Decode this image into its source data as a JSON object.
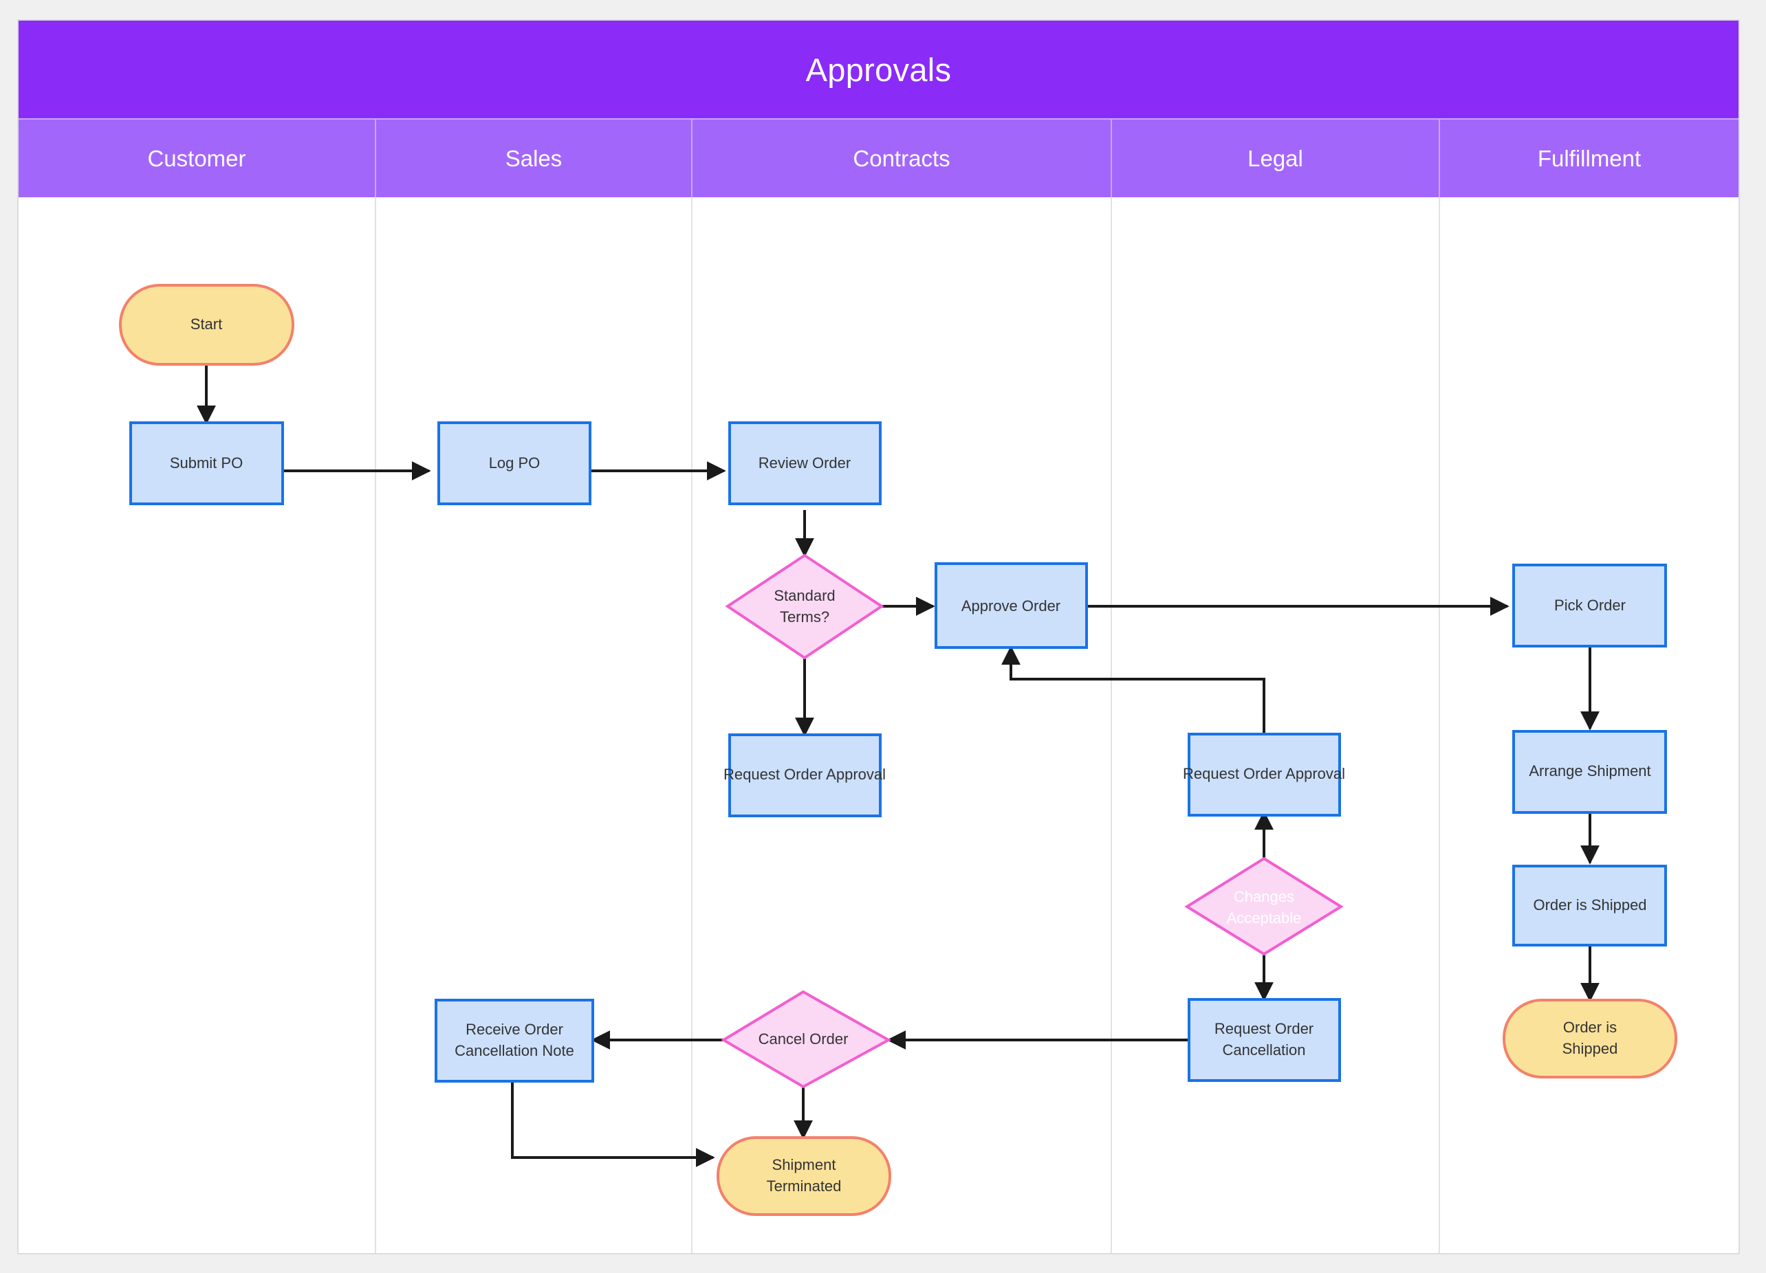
{
  "diagram": {
    "title": "Approvals",
    "type": "swimlane-flowchart",
    "colors": {
      "title_bar": "#8A2BF7",
      "lane_header": "#A366FB",
      "page_background": "#F0F0F0",
      "canvas": "#FFFFFF",
      "process_fill": "#CCE0FC",
      "process_border": "#1A73E8",
      "decision_fill": "#FBD9F5",
      "decision_border": "#F25FD0",
      "terminal_fill": "#FBE29A",
      "terminal_border": "#F4806A",
      "connector": "#1A1A1A",
      "lane_divider": "#E2E2E2"
    },
    "lanes": [
      {
        "id": "customer",
        "label": "Customer"
      },
      {
        "id": "sales",
        "label": "Sales"
      },
      {
        "id": "contracts",
        "label": "Contracts"
      },
      {
        "id": "legal",
        "label": "Legal"
      },
      {
        "id": "fulfillment",
        "label": "Fulfillment"
      }
    ],
    "nodes": [
      {
        "id": "start",
        "label": "Start",
        "shape": "terminal",
        "lane": "customer"
      },
      {
        "id": "submit_po",
        "label": "Submit PO",
        "shape": "process",
        "lane": "customer"
      },
      {
        "id": "log_po",
        "label": "Log PO",
        "shape": "process",
        "lane": "sales"
      },
      {
        "id": "review_order",
        "label": "Review Order",
        "shape": "process",
        "lane": "contracts"
      },
      {
        "id": "standard_terms",
        "label": "Standard Terms?",
        "label_line1": "Standard",
        "label_line2": "Terms?",
        "shape": "decision",
        "lane": "contracts"
      },
      {
        "id": "approve_order",
        "label": "Approve Order",
        "shape": "process",
        "lane": "contracts"
      },
      {
        "id": "contracts_request_approval",
        "label": "Request Order Approval",
        "shape": "process",
        "lane": "contracts"
      },
      {
        "id": "legal_request_approval",
        "label": "Request Order Approval",
        "shape": "process",
        "lane": "legal"
      },
      {
        "id": "changes_acceptable",
        "label": "Changes Acceptable",
        "label_line1": "Changes",
        "label_line2": "Acceptable",
        "shape": "decision",
        "lane": "legal",
        "text_color": "white"
      },
      {
        "id": "request_cancellation",
        "label": "Request Order Cancellation",
        "label_line1": "Request Order",
        "label_line2": "Cancellation",
        "shape": "process",
        "lane": "legal"
      },
      {
        "id": "cancel_order",
        "label": "Cancel Order",
        "shape": "decision",
        "lane": "contracts"
      },
      {
        "id": "receive_cancellation_note",
        "label": "Receive Order Cancellation Note",
        "label_line1": "Receive Order",
        "label_line2": "Cancellation Note",
        "shape": "process",
        "lane": "sales"
      },
      {
        "id": "shipment_terminated",
        "label": "Shipment Terminated",
        "label_line1": "Shipment",
        "label_line2": "Terminated",
        "shape": "terminal",
        "lane": "contracts"
      },
      {
        "id": "pick_order",
        "label": "Pick Order",
        "shape": "process",
        "lane": "fulfillment"
      },
      {
        "id": "arrange_shipment",
        "label": "Arrange Shipment",
        "shape": "process",
        "lane": "fulfillment"
      },
      {
        "id": "order_is_shipped_step",
        "label": "Order is Shipped",
        "shape": "process",
        "lane": "fulfillment"
      },
      {
        "id": "order_is_shipped_end",
        "label": "Order is Shipped",
        "label_line1": "Order is",
        "label_line2": "Shipped",
        "shape": "terminal",
        "lane": "fulfillment"
      }
    ],
    "edges": [
      {
        "from": "start",
        "to": "submit_po"
      },
      {
        "from": "submit_po",
        "to": "log_po"
      },
      {
        "from": "log_po",
        "to": "review_order"
      },
      {
        "from": "review_order",
        "to": "standard_terms"
      },
      {
        "from": "standard_terms",
        "to": "approve_order"
      },
      {
        "from": "standard_terms",
        "to": "contracts_request_approval"
      },
      {
        "from": "approve_order",
        "to": "pick_order"
      },
      {
        "from": "legal_request_approval",
        "to": "approve_order"
      },
      {
        "from": "changes_acceptable",
        "to": "legal_request_approval"
      },
      {
        "from": "changes_acceptable",
        "to": "request_cancellation"
      },
      {
        "from": "request_cancellation",
        "to": "cancel_order"
      },
      {
        "from": "cancel_order",
        "to": "receive_cancellation_note"
      },
      {
        "from": "cancel_order",
        "to": "shipment_terminated"
      },
      {
        "from": "receive_cancellation_note",
        "to": "shipment_terminated"
      },
      {
        "from": "pick_order",
        "to": "arrange_shipment"
      },
      {
        "from": "arrange_shipment",
        "to": "order_is_shipped_step"
      },
      {
        "from": "order_is_shipped_step",
        "to": "order_is_shipped_end"
      }
    ]
  }
}
